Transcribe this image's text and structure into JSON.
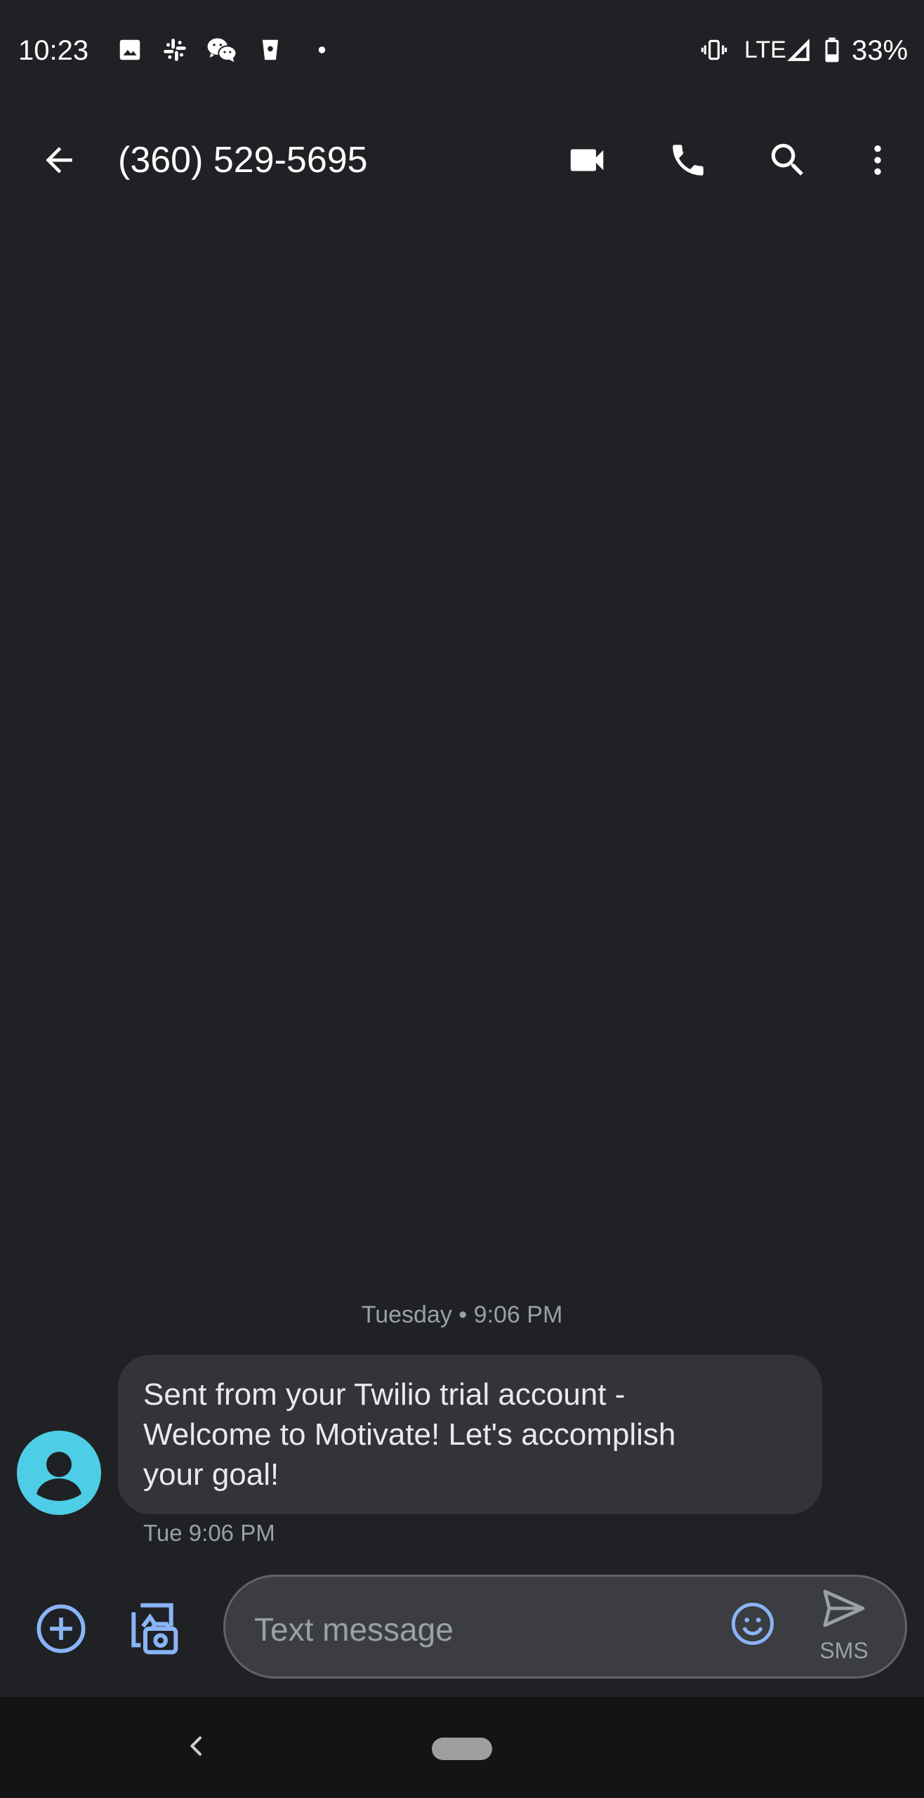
{
  "status_bar": {
    "time": "10:23",
    "notification_icons": [
      "image-icon",
      "slack-icon",
      "wechat-icon",
      "starbucks-icon",
      "dot-icon"
    ],
    "network": "LTE",
    "battery_percent": "33%",
    "system_icons": [
      "vibrate-icon",
      "signal-icon",
      "battery-icon"
    ]
  },
  "app_bar": {
    "title": "(360) 529-5695",
    "actions": [
      "back-arrow-icon",
      "video-call-icon",
      "phone-icon",
      "search-icon",
      "more-vert-icon"
    ]
  },
  "conversation": {
    "date_divider": "Tuesday • 9:06 PM",
    "messages": [
      {
        "direction": "incoming",
        "text": "Sent from your Twilio trial account -\nWelcome to Motivate! Let's accomplish\nyour goal!",
        "timestamp": "Tue 9:06 PM"
      }
    ]
  },
  "compose": {
    "placeholder": "Text message",
    "value": "",
    "send_label": "SMS"
  },
  "colors": {
    "background": "#202124",
    "bubble": "#323437",
    "accent": "#8ab4f8",
    "avatar": "#4ecde6"
  }
}
